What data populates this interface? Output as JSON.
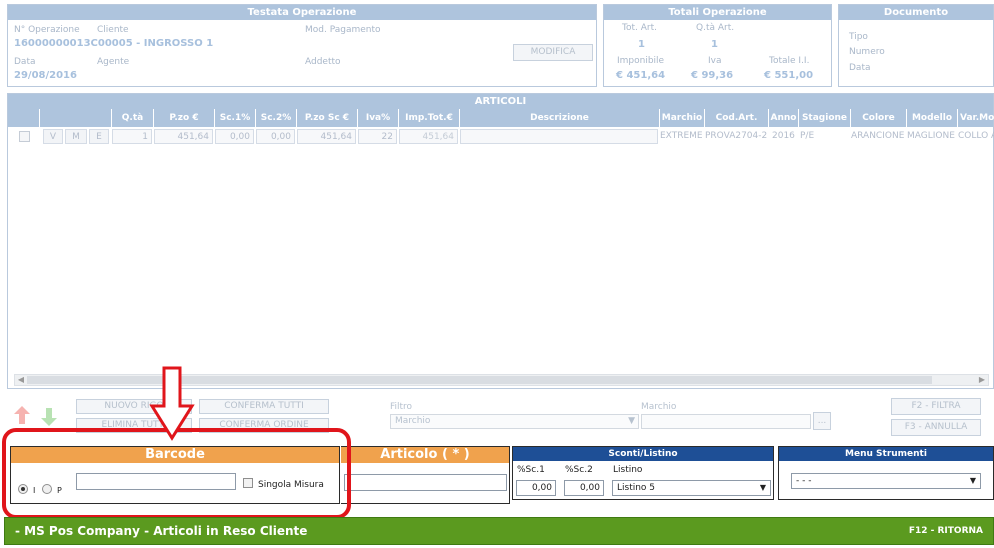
{
  "testata": {
    "title": "Testata Operazione",
    "num_op_label": "N° Operazione",
    "cliente_label": "Cliente",
    "mod_pag_label": "Mod. Pagamento",
    "value": "16000000013C00005 - INGROSSO 1",
    "data_label": "Data",
    "agente_label": "Agente",
    "addetto_label": "Addetto",
    "data_value": "29/08/2016",
    "modifica_label": "MODIFICA"
  },
  "totali": {
    "title": "Totali Operazione",
    "tot_art_label": "Tot. Art.",
    "qta_art_label": "Q.tà Art.",
    "tot_art_value": "1",
    "qta_art_value": "1",
    "imponibile_label": "Imponibile",
    "iva_label": "Iva",
    "totale_label": "Totale I.I.",
    "imponibile_value": "€ 451,64",
    "iva_value": "€ 99,36",
    "totale_value": "€ 551,00"
  },
  "documento": {
    "title": "Documento",
    "tipo_label": "Tipo",
    "numero_label": "Numero",
    "data_label": "Data"
  },
  "articoli": {
    "title": "ARTICOLI",
    "columns": [
      "Q.tà",
      "P.zo €",
      "Sc.1%",
      "Sc.2%",
      "P.zo Sc €",
      "Iva%",
      "Imp.Tot.€",
      "Descrizione",
      "Marchio",
      "Cod.Art.",
      "Anno",
      "Stagione",
      "Colore",
      "Modello",
      "Var.Mo"
    ],
    "row": {
      "btn_v": "V",
      "btn_m": "M",
      "btn_e": "E",
      "qta": "1",
      "prezzo": "451,64",
      "sc1": "0,00",
      "sc2": "0,00",
      "prezzo_sc": "451,64",
      "iva": "22",
      "imp_tot": "451,64",
      "descrizione": "",
      "marchio": "EXTREME",
      "cod_art": "PROVA2704-2",
      "anno": "2016",
      "stagione": "P/E",
      "colore": "ARANCIONE",
      "modello": "MAGLIONE",
      "var_mod": "COLLO A"
    }
  },
  "toolbar": {
    "nuovo_rigo": "NUOVO RIGO",
    "conferma_tutti": "CONFERMA TUTTI",
    "elimina_tutti": "ELIMINA TUTTI",
    "conferma_ordine": "CONFERMA ORDINE",
    "filtro_label": "Filtro",
    "filtro_value": "Marchio",
    "marchio_label": "Marchio",
    "marchio_btn": "...",
    "f2_filtra": "F2 - FILTRA",
    "f3_annulla": "F3 - ANNULLA"
  },
  "barcode": {
    "title": "Barcode",
    "radio_i": "I",
    "radio_p": "P",
    "input_value": "",
    "singola_misura": "Singola Misura"
  },
  "articolo": {
    "title": "Articolo ( * )",
    "input_value": ""
  },
  "sconti": {
    "title": "Sconti/Listino",
    "sc1_label": "%Sc.1",
    "sc2_label": "%Sc.2",
    "listino_label": "Listino",
    "sc1_value": "0,00",
    "sc2_value": "0,00",
    "listino_value": "Listino 5"
  },
  "menu_strumenti": {
    "title": "Menu Strumenti",
    "value": "- - -"
  },
  "footer": {
    "title": "- MS Pos Company - Articoli in Reso Cliente",
    "ritorna": "F12 - RITORNA"
  },
  "colors": {
    "header_blue": "#aec4dd",
    "orange": "#f0a24d",
    "navy": "#1e4f96",
    "footer_green": "#5b9a1f",
    "highlight_red": "#e0151b"
  }
}
